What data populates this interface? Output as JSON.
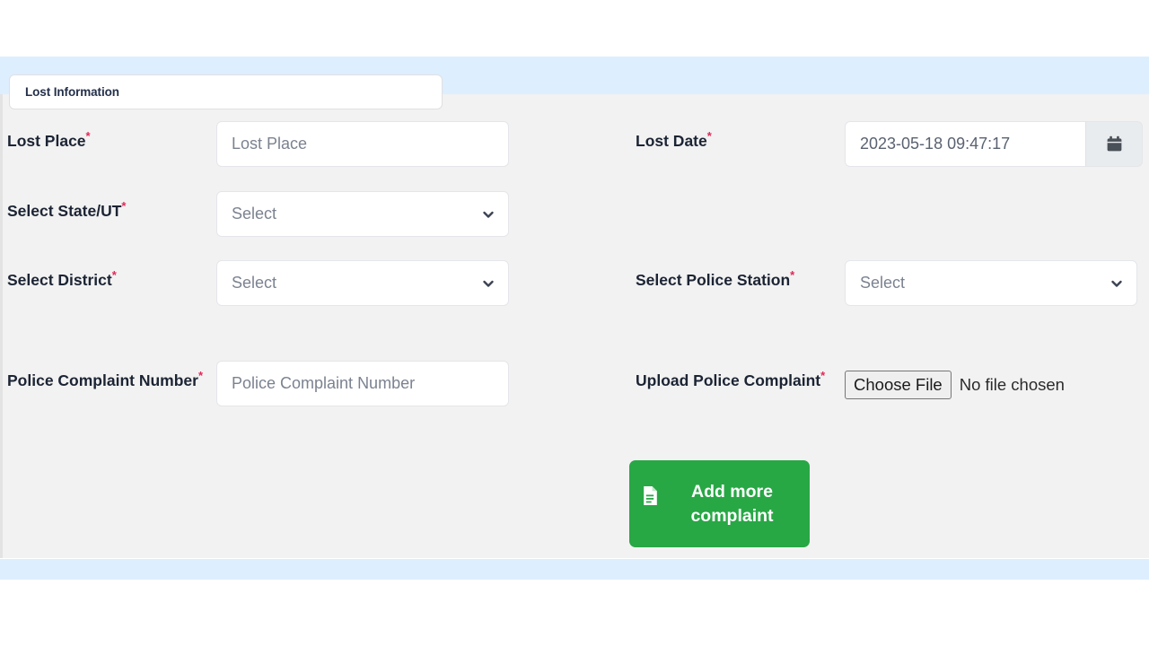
{
  "theme": {
    "band_color": "#ddeeff",
    "panel_bg": "#f2f2f2",
    "accent_green": "#28a745",
    "required_marker_color": "#e0285a",
    "label_color": "#1c2434",
    "placeholder_color": "#7b8290"
  },
  "tab": {
    "label": "Lost Information"
  },
  "form": {
    "required_marker": "*",
    "rows": [
      {
        "left": {
          "label": "Lost Place",
          "required": true,
          "control": "text",
          "placeholder": "Lost Place",
          "value": ""
        },
        "right": {
          "label": "Lost Date",
          "required": true,
          "control": "datetime",
          "value": "2023-05-18 09:47:17",
          "addon_icon": "calendar-icon"
        }
      },
      {
        "left": {
          "label": "Select State/UT",
          "required": true,
          "control": "select",
          "value": "Select",
          "icon": "chevron-down-icon"
        },
        "right": null
      },
      {
        "left": {
          "label": "Select District",
          "required": true,
          "control": "select",
          "value": "Select",
          "icon": "chevron-down-icon"
        },
        "right": {
          "label": "Select Police Station",
          "required": true,
          "control": "select",
          "value": "Select",
          "icon": "chevron-down-icon"
        }
      },
      {
        "left": {
          "label": "Police Complaint Number",
          "required": true,
          "control": "text",
          "placeholder": "Police Complaint Number",
          "value": ""
        },
        "right": {
          "label": "Upload Police Complaint",
          "required": true,
          "control": "file",
          "button_label": "Choose File",
          "file_status": "No file chosen"
        }
      }
    ],
    "add_button": {
      "label": "Add more complaint",
      "icon": "file-lines-icon",
      "color": "#28a745"
    }
  }
}
